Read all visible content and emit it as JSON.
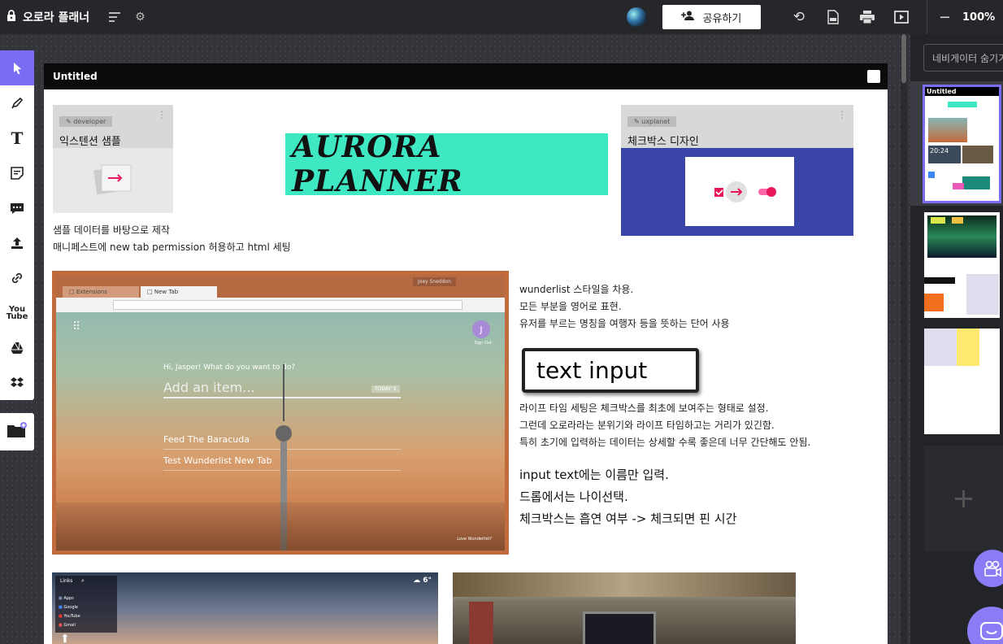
{
  "app": {
    "title": "오로라 플래너",
    "share_label": "공유하기",
    "zoom": "100%"
  },
  "page": {
    "header": "Untitled"
  },
  "cards": [
    {
      "tag": "developer",
      "title": "익스텐션 샘플"
    },
    {
      "tag": "uxplanet",
      "title": "체크박스 디자인"
    }
  ],
  "banner_text": "AURORA PLANNER",
  "notes": {
    "sample": [
      "샘플 데이터를 바탕으로 제작",
      "매니페스트에 new tab permission 허용하고 html 세팅"
    ],
    "style": [
      "wunderlist 스타일을 차용.",
      "모든 부분을 영어로 표현.",
      "유저를 부르는 명칭을 여행자 등을 뜻하는 단어 사용"
    ],
    "lifetime": [
      "라이프 타임 세팅은 체크박스를 최초에 보여주는 형태로 설정.",
      "그런데 오로라라는 분위기와 라이프 타임하고는 거리가 있긴함.",
      "특히 초기에 입력하는 데이터는 상세할 수록 좋은데 너무 간단해도 안됨."
    ],
    "input": [
      "input text에는 이름만 입력.",
      "드롭에서는 나이선택.",
      "체크박스는 흡연 여부 -> 체크되면 핀 시간"
    ]
  },
  "text_input_label": "text input",
  "screenshot1": {
    "tab1": "Extensions",
    "tab2": "New Tab",
    "user": "Joey Sneddon",
    "greeting": "Hi, Jasper! What do you want to do?",
    "placeholder": "Add an item...",
    "today": "TODAY ↕",
    "item1": "Feed The Baracuda",
    "item2": "Test Wunderlist New Tab",
    "signout": "Sign Out",
    "avatar": "J",
    "footer": "Love Wunderlist?"
  },
  "screenshot2": {
    "links_label": "Links",
    "weather": "6°",
    "links": [
      "Apps",
      "Google",
      "YouTube",
      "Gmail"
    ]
  },
  "right_panel": {
    "nav_search_placeholder": "네비게이터 숨기기",
    "thumb_title": "Untitled",
    "thumb_time": "20:24"
  },
  "colors": {
    "accent": "#7b6cf6",
    "banner": "#3de8c3",
    "checkbox_bg": "#3a45a8",
    "pink": "#e8195a"
  }
}
